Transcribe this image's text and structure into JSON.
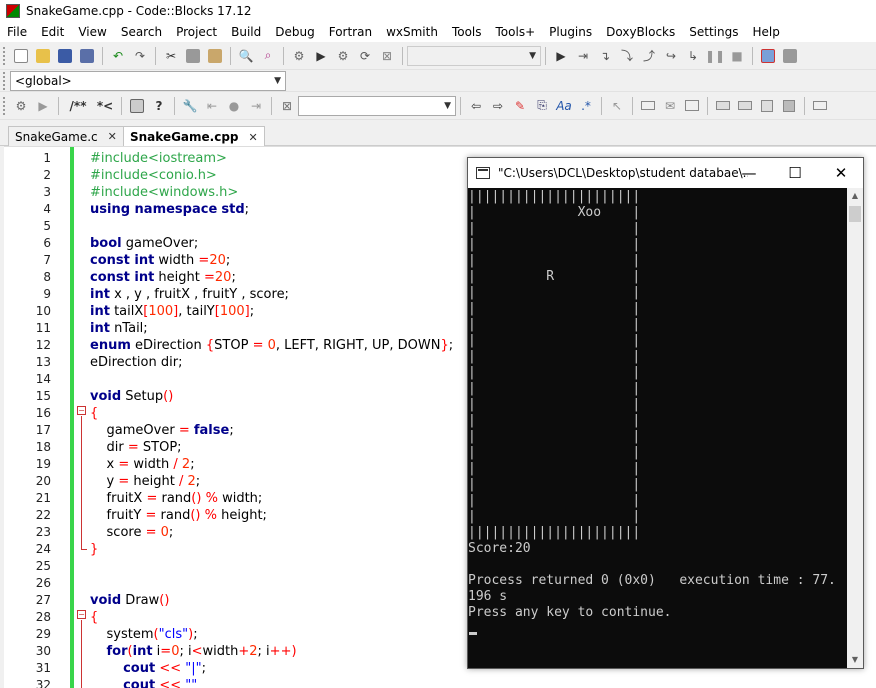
{
  "window": {
    "title": "SnakeGame.cpp - Code::Blocks 17.12"
  },
  "menu": [
    "File",
    "Edit",
    "View",
    "Search",
    "Project",
    "Build",
    "Debug",
    "Fortran",
    "wxSmith",
    "Tools",
    "Tools+",
    "Plugins",
    "DoxyBlocks",
    "Settings",
    "Help"
  ],
  "scope_combo": {
    "value": "<global>"
  },
  "doxy_toolbar": {
    "comment_block": "/**",
    "comment_line": "*<"
  },
  "tabs": [
    {
      "label": "SnakeGame.c",
      "close": "✕"
    },
    {
      "label": "SnakeGame.cpp",
      "close": "✕"
    }
  ],
  "editor": {
    "lines": [
      {
        "n": "1",
        "html": "<span class='pp'>#include&lt;iostream&gt;</span>"
      },
      {
        "n": "2",
        "html": "<span class='pp'>#include&lt;conio.h&gt;</span>"
      },
      {
        "n": "3",
        "html": "<span class='pp'>#include&lt;windows.h&gt;</span>"
      },
      {
        "n": "4",
        "html": "<span class='kw'>using namespace</span> <span class='kw'>std</span>;"
      },
      {
        "n": "5",
        "html": ""
      },
      {
        "n": "6",
        "html": "<span class='kw'>bool</span> gameOver;"
      },
      {
        "n": "7",
        "html": "<span class='kw'>const int</span> width <span class='op'>=</span><span class='num'>20</span>;"
      },
      {
        "n": "8",
        "html": "<span class='kw'>const int</span> height <span class='op'>=</span><span class='num'>20</span>;"
      },
      {
        "n": "9",
        "html": "<span class='kw'>int</span> x , y , fruitX , fruitY , score;"
      },
      {
        "n": "10",
        "html": "<span class='kw'>int</span> tailX<span class='op'>[</span><span class='num'>100</span><span class='op'>]</span>, tailY<span class='op'>[</span><span class='num'>100</span><span class='op'>]</span>;"
      },
      {
        "n": "11",
        "html": "<span class='kw'>int</span> nTail;"
      },
      {
        "n": "12",
        "html": "<span class='kw'>enum</span> eDirection <span class='op'>{</span>STOP <span class='op'>=</span> <span class='num'>0</span>, LEFT, RIGHT, UP, DOWN<span class='op'>}</span>;"
      },
      {
        "n": "13",
        "html": "eDirection dir;"
      },
      {
        "n": "14",
        "html": ""
      },
      {
        "n": "15",
        "html": "<span class='kw'>void</span> Setup<span class='op'>()</span>"
      },
      {
        "n": "16",
        "html": "<span class='op'>{</span>"
      },
      {
        "n": "17",
        "html": "    gameOver <span class='op'>=</span> <span class='kw'>false</span>;"
      },
      {
        "n": "18",
        "html": "    dir <span class='op'>=</span> STOP;"
      },
      {
        "n": "19",
        "html": "    x <span class='op'>=</span> width <span class='op'>/</span> <span class='num'>2</span>;"
      },
      {
        "n": "20",
        "html": "    y <span class='op'>=</span> height <span class='op'>/</span> <span class='num'>2</span>;"
      },
      {
        "n": "21",
        "html": "    fruitX <span class='op'>=</span> rand<span class='op'>()</span> <span class='op'>%</span> width;"
      },
      {
        "n": "22",
        "html": "    fruitY <span class='op'>=</span> rand<span class='op'>()</span> <span class='op'>%</span> height;"
      },
      {
        "n": "23",
        "html": "    score <span class='op'>=</span> <span class='num'>0</span>;"
      },
      {
        "n": "24",
        "html": "<span class='op'>}</span>"
      },
      {
        "n": "25",
        "html": ""
      },
      {
        "n": "26",
        "html": ""
      },
      {
        "n": "27",
        "html": "<span class='kw'>void</span> Draw<span class='op'>()</span>"
      },
      {
        "n": "28",
        "html": "<span class='op'>{</span>"
      },
      {
        "n": "29",
        "html": "    system<span class='op'>(</span><span class='str'>\"cls\"</span><span class='op'>)</span>;"
      },
      {
        "n": "30",
        "html": "    <span class='kw'>for</span><span class='op'>(</span><span class='kw'>int</span> i<span class='op'>=</span><span class='num'>0</span>; i<span class='op'>&lt;</span>width<span class='op'>+</span><span class='num'>2</span>; i<span class='op'>++)</span>"
      },
      {
        "n": "31",
        "html": "        <span class='kw'>cout</span> <span class='op'>&lt;&lt;</span> <span class='str'>\"|\"</span>;"
      },
      {
        "n": "32",
        "html": "        <span class='kw'>cout</span> <span class='op'>&lt;&lt;</span> <span class='str'>\"\"</span>"
      }
    ]
  },
  "console": {
    "title": "\"C:\\Users\\DCL\\Desktop\\student databae\\...",
    "minimize": "—",
    "maximize": "☐",
    "close": "✕",
    "lines": [
      "||||||||||||||||||||||",
      "|             Xoo    |",
      "|                    |",
      "|                    |",
      "|                    |",
      "|         R          |",
      "|                    |",
      "|                    |",
      "|                    |",
      "|                    |",
      "|                    |",
      "|                    |",
      "|                    |",
      "|                    |",
      "|                    |",
      "|                    |",
      "|                    |",
      "|                    |",
      "|                    |",
      "|                    |",
      "|                    |",
      "||||||||||||||||||||||",
      "Score:20",
      "",
      "Process returned 0 (0x0)   execution time : 77.",
      "196 s",
      "Press any key to continue."
    ]
  }
}
